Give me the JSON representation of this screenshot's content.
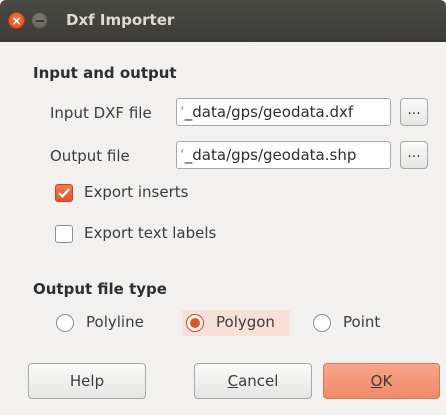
{
  "window": {
    "title": "Dxf Importer"
  },
  "input_output": {
    "heading": "Input and output",
    "input_label": "Input DXF file",
    "input_value": "_data/gps/geodata.dxf",
    "output_label": "Output file",
    "output_value": "_data/gps/geodata.shp",
    "browse_label": "...",
    "export_inserts_label": "Export inserts",
    "export_inserts_checked": true,
    "export_text_labels_label": "Export text labels",
    "export_text_labels_checked": false
  },
  "output_type": {
    "heading": "Output file type",
    "options": [
      {
        "label": "Polyline",
        "selected": false
      },
      {
        "label": "Polygon",
        "selected": true
      },
      {
        "label": "Point",
        "selected": false
      }
    ]
  },
  "buttons": {
    "help": "Help",
    "cancel_mnemonic": "C",
    "cancel_rest": "ancel",
    "ok_mnemonic": "O",
    "ok_rest": "K"
  },
  "colors": {
    "accent": "#e2532a",
    "titlebar": "#3c3b37"
  }
}
